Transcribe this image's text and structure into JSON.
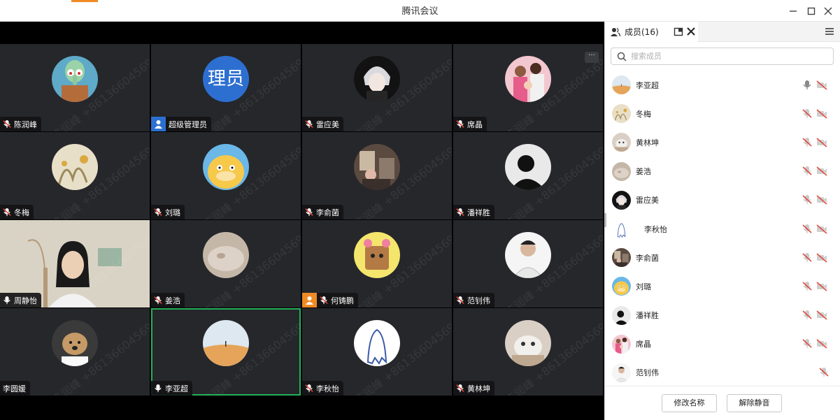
{
  "window": {
    "title": "腾讯会议"
  },
  "video_grid": {
    "tiles": [
      {
        "name": "陈润峰",
        "mic": "muted",
        "avatar": "squidward"
      },
      {
        "name": "超级管理员",
        "mic": "none",
        "avatar_text": "理员",
        "role_icon": "user-icon"
      },
      {
        "name": "雷应美",
        "mic": "muted",
        "avatar": "anime-boy"
      },
      {
        "name": "席晶",
        "mic": "muted",
        "avatar": "family"
      },
      {
        "name": "冬梅",
        "mic": "muted",
        "avatar": "painting"
      },
      {
        "name": "刘璐",
        "mic": "muted",
        "avatar": "psyduck"
      },
      {
        "name": "李俞菌",
        "mic": "muted",
        "avatar": "room"
      },
      {
        "name": "潘祥胜",
        "mic": "muted",
        "avatar": "silhouette"
      },
      {
        "name": "周静怡",
        "mic": "on",
        "avatar": "camera"
      },
      {
        "name": "姜浩",
        "mic": "muted",
        "avatar": "pebble"
      },
      {
        "name": "何铸鹏",
        "mic": "muted",
        "avatar": "cartoon-bear",
        "role_icon": "user-icon"
      },
      {
        "name": "范钊伟",
        "mic": "muted",
        "avatar": "man-white"
      },
      {
        "name": "李圆媛",
        "mic": "none",
        "avatar": "dog"
      },
      {
        "name": "李亚超",
        "mic": "on",
        "avatar": "desert"
      },
      {
        "name": "李秋怡",
        "mic": "muted",
        "avatar": "ghost"
      },
      {
        "name": "黄林坤",
        "mic": "muted",
        "avatar": "cat"
      }
    ],
    "watermark": "陈润峰 +8613660456973",
    "more_label": "···"
  },
  "sidebar": {
    "tab_label": "成员(16)",
    "search_placeholder": "搜索成员",
    "members": [
      {
        "name": "李亚超",
        "mic": "on"
      },
      {
        "name": "冬梅",
        "mic": "muted"
      },
      {
        "name": "黄林坤",
        "mic": "muted"
      },
      {
        "name": "姜浩",
        "mic": "muted"
      },
      {
        "name": "雷应美",
        "mic": "muted"
      },
      {
        "name": "李秋怡",
        "mic": "muted"
      },
      {
        "name": "李俞菌",
        "mic": "muted"
      },
      {
        "name": "刘璐",
        "mic": "muted"
      },
      {
        "name": "潘祥胜",
        "mic": "muted"
      },
      {
        "name": "席晶",
        "mic": "muted"
      },
      {
        "name": "范钊伟",
        "mic": "muted"
      }
    ],
    "rename_label": "修改名称",
    "unmute_label": "解除静音"
  },
  "colors": {
    "active_speaker": "#23b05a",
    "muted_mic": "#e04a3f",
    "admin_avatar": "#2d6fd0",
    "accent": "#f08a24"
  }
}
